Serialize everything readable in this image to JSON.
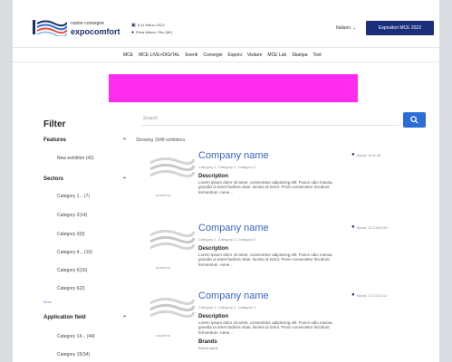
{
  "header": {
    "logo_top": "nostre consegne",
    "logo_main": "expocomfort",
    "date": "8-11 Marzo 2022",
    "venue": "Fiera Milano, Rho (MI)",
    "language": "Italiano",
    "cta_label": "Espositori MCE 2022"
  },
  "nav": {
    "items": [
      "MCE",
      "MCE LIVE+DIGITAL",
      "Eventi",
      "Convegni",
      "Esponi",
      "Visitare",
      "MCE Lab",
      "Stampa",
      "Tool"
    ]
  },
  "filter": {
    "title": "Filter",
    "features": {
      "label": "Features",
      "options": [
        "New exhibitor (42)"
      ]
    },
    "sectors": {
      "label": "Sectors",
      "options": [
        "Category 1... (7)",
        "Category 2(14)",
        "Category 3(9)",
        "Category 4... (16)",
        "Category 5(16)",
        "Category 6(2)"
      ]
    },
    "more_label": "More",
    "application": {
      "label": "Application field",
      "options": [
        "Category 14... (44)",
        "Category 15(34)"
      ]
    }
  },
  "search": {
    "placeholder": "Search",
    "showing": "Showing 1548 exhibitors"
  },
  "cards": [
    {
      "name": "Company name",
      "cats": "Category 1, Category 2, Category 3",
      "desc_label": "Description",
      "desc": "Lorem ipsum dolor sit amet, consectetur adipiscing elit. Fusce odio massa, gravida ut amet facilisis vitae, lacinia id tortor. Proin consectetur tincidunt fermentum. Aene...",
      "loc": "Stand: 12 B 45",
      "thumb_caption": "EXHIBITOR"
    },
    {
      "name": "Company name",
      "cats": "Category 1, Category 2, Category 3",
      "desc_label": "Description",
      "desc": "Lorem ipsum dolor sit amet, consectetur adipiscing elit. Fusce odio massa, gravida ut amet facilisis vitae, lacinia id tortor. Proin consectetur tincidunt fermentum. Aene...",
      "loc": "Stand: 12 C40/C69",
      "thumb_caption": "EXHIBITOR"
    },
    {
      "name": "Company name",
      "cats": "Category 1, Category 2, Category 3",
      "desc_label": "Description",
      "desc": "Lorem ipsum dolor sit amet, consectetur adipiscing elit. Fusce odio massa, gravida ut amet facilisis vitae, lacinia id tortor. Proin consectetur tincidunt fermentum. Aene...",
      "loc": "Stand: 12 C11/C12",
      "thumb_caption": "EXHIBITOR",
      "brands_label": "Brands",
      "brands": "Brand name"
    }
  ],
  "colors": {
    "brand_navy": "#1a2e7a",
    "link_blue": "#3a63c4",
    "search_blue": "#2c6ed6",
    "banner_magenta": "#ff2cf0"
  }
}
